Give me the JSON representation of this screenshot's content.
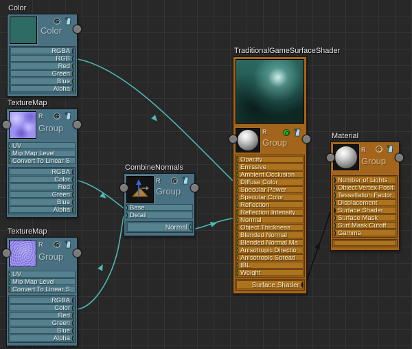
{
  "canvas": {
    "background": "#282828",
    "grid_color": "#343434",
    "grid_size_px": 24
  },
  "badges": {
    "value": "V"
  },
  "palette": {
    "node_blue": "#4a7181",
    "node_orange": "#a3641b",
    "row_blue": "#56828f",
    "row_orange": "#ad731e",
    "wire_teal": "#4fb8b4",
    "wire_black": "#111111",
    "port_green": "#54c32f",
    "port_cyan": "#3cc3c3",
    "port_magenta": "#c93ac9",
    "port_yellow": "#e2c352",
    "port_gray": "#7b7b7b",
    "port_black": "#0d0d0d",
    "port_value_blue": "#2a52c8",
    "port_value_orange": "#c67818",
    "color_swatch": "#2d6b64"
  },
  "nodes": {
    "color": {
      "title": "Color",
      "header_label": "Color",
      "outputs": [
        {
          "label": "RGBA",
          "port": "magenta"
        },
        {
          "label": "RGB",
          "port": "cyan"
        },
        {
          "label": "Red",
          "port": "green"
        },
        {
          "label": "Green",
          "port": "green"
        },
        {
          "label": "Blue",
          "port": "green"
        },
        {
          "label": "Alpha",
          "port": "green"
        }
      ]
    },
    "texturemap1": {
      "title": "TextureMap",
      "r_label": "R",
      "header_label": "Group",
      "inputs": [
        {
          "label": "UV",
          "port": "yellow"
        },
        {
          "label": "Mip Map Level",
          "port": "green"
        },
        {
          "label": "Convert To Linear S",
          "port": "value-orange"
        }
      ],
      "outputs": [
        {
          "label": "RGBA",
          "port": "magenta"
        },
        {
          "label": "Color",
          "port": "cyan"
        },
        {
          "label": "Red",
          "port": "green"
        },
        {
          "label": "Green",
          "port": "green"
        },
        {
          "label": "Blue",
          "port": "green"
        },
        {
          "label": "Alpha",
          "port": "green"
        }
      ]
    },
    "texturemap2": {
      "title": "TextureMap",
      "r_label": "R",
      "header_label": "Group",
      "inputs": [
        {
          "label": "UV",
          "port": "yellow"
        },
        {
          "label": "Mip Map Level",
          "port": "green"
        },
        {
          "label": "Convert To Linear S",
          "port": "value-orange"
        }
      ],
      "outputs": [
        {
          "label": "RGBA",
          "port": "magenta"
        },
        {
          "label": "Color",
          "port": "cyan"
        },
        {
          "label": "Red",
          "port": "green"
        },
        {
          "label": "Green",
          "port": "green"
        },
        {
          "label": "Blue",
          "port": "green"
        },
        {
          "label": "Alpha",
          "port": "green"
        }
      ]
    },
    "combinenormals": {
      "title": "CombineNormals",
      "r_label": "R",
      "header_label": "Group",
      "inputs": [
        {
          "label": "Base",
          "port": "cyan"
        },
        {
          "label": "Detail",
          "port": "cyan"
        }
      ],
      "outputs": [
        {
          "label": "Normal",
          "port": "cyan"
        }
      ]
    },
    "shader": {
      "title": "TraditionalGameSurfaceShader",
      "r_label": "R",
      "header_label": "Group",
      "inputs": [
        {
          "label": "Opacity",
          "port": "green"
        },
        {
          "label": "Emissive",
          "port": "cyan"
        },
        {
          "label": "Ambient Occlusion",
          "port": "green"
        },
        {
          "label": "Diffuse Color",
          "port": "cyan"
        },
        {
          "label": "Specular Power",
          "port": "green"
        },
        {
          "label": "Specular Color",
          "port": "cyan"
        },
        {
          "label": "Reflection",
          "port": "cyan"
        },
        {
          "label": "Reflection Intensity",
          "port": "green"
        },
        {
          "label": "Normal",
          "port": "cyan"
        },
        {
          "label": "Object Thickness",
          "port": "green"
        },
        {
          "label": "Blended Normal",
          "port": "green"
        },
        {
          "label": "Blended Normal Ma",
          "port": "green"
        },
        {
          "label": "Anisotropic Directio",
          "port": "cyan"
        },
        {
          "label": "Anisotropic Spread",
          "port": "yellow"
        },
        {
          "label": "IBL",
          "port": "cyan"
        },
        {
          "label": "Weight",
          "port": "green"
        }
      ],
      "outputs": [
        {
          "label": "Surface Shader",
          "port": "black"
        }
      ]
    },
    "material": {
      "title": "Material",
      "r_label": "R",
      "header_label": "Group",
      "inputs": [
        {
          "label": "Number of Lights",
          "port": "value-blue"
        },
        {
          "label": "Object Vertex Posit",
          "port": "cyan"
        },
        {
          "label": "Tessellation Factor",
          "port": "green"
        },
        {
          "label": "Displacement",
          "port": "cyan"
        },
        {
          "label": "Surface Shader",
          "port": "black"
        },
        {
          "label": "Surface Mask",
          "port": "green"
        },
        {
          "label": "Surf Mask Cutoff",
          "port": "green"
        },
        {
          "label": "Gamma",
          "port": "value-orange"
        }
      ]
    }
  },
  "connections": [
    {
      "from": "Color.RGB",
      "to": "TraditionalGameSurfaceShader.Diffuse Color"
    },
    {
      "from": "TextureMap(top).Color",
      "to": "CombineNormals.Base"
    },
    {
      "from": "TextureMap(bottom).Color",
      "to": "CombineNormals.Detail"
    },
    {
      "from": "CombineNormals.Normal",
      "to": "TraditionalGameSurfaceShader.Normal"
    },
    {
      "from": "TraditionalGameSurfaceShader.Surface Shader",
      "to": "Material.Surface Shader"
    }
  ]
}
